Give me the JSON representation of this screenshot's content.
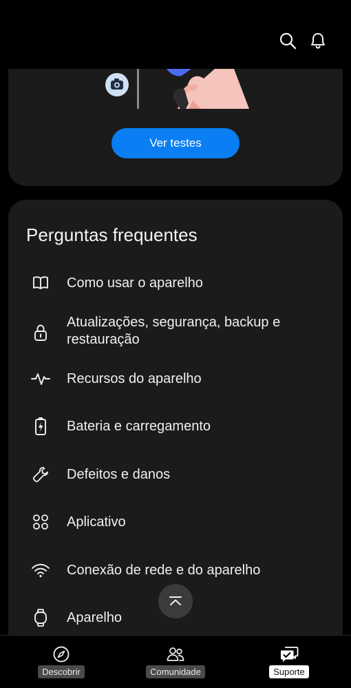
{
  "topbar": {
    "search_icon": "search-icon",
    "bell_icon": "bell-icon"
  },
  "promo": {
    "button_label": "Ver testes"
  },
  "faq": {
    "title": "Perguntas frequentes",
    "items": [
      {
        "label": "Como usar o aparelho",
        "icon": "book-icon"
      },
      {
        "label": "Atualizações, segurança, backup e restauração",
        "icon": "lock-icon"
      },
      {
        "label": "Recursos do aparelho",
        "icon": "pulse-icon"
      },
      {
        "label": "Bateria e carregamento",
        "icon": "battery-charging-icon"
      },
      {
        "label": "Defeitos e danos",
        "icon": "wrench-icon"
      },
      {
        "label": "Aplicativo",
        "icon": "apps-icon"
      },
      {
        "label": "Conexão de rede e do aparelho",
        "icon": "wifi-icon"
      },
      {
        "label": "Aparelho",
        "icon": "watch-icon"
      }
    ]
  },
  "bottom_nav": {
    "items": [
      {
        "label": "Descobrir",
        "icon": "compass-icon",
        "active": false
      },
      {
        "label": "Comunidade",
        "icon": "community-icon",
        "active": false
      },
      {
        "label": "Suporte",
        "icon": "support-chat-icon",
        "active": true
      }
    ]
  },
  "colors": {
    "accent": "#0a7ef2",
    "card": "#1b1b1b",
    "background": "#000000"
  }
}
